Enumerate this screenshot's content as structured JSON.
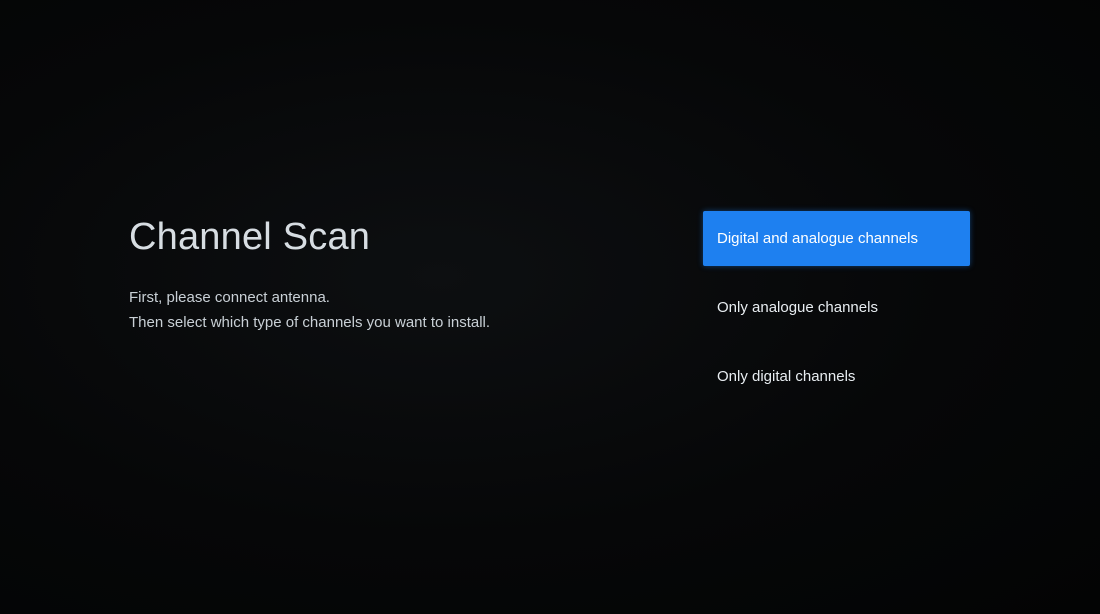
{
  "page": {
    "title": "Channel Scan",
    "description_lines": [
      "First, please connect antenna.",
      "Then select which type of channels you want to install."
    ]
  },
  "menu": {
    "selected_index": 0,
    "options": [
      {
        "label": "Digital and analogue channels"
      },
      {
        "label": "Only analogue channels"
      },
      {
        "label": "Only digital channels"
      }
    ]
  },
  "colors": {
    "background": "#050607",
    "highlight": "#1e80f0",
    "title_text": "#d7dde2",
    "body_text": "#c9d0d6"
  }
}
